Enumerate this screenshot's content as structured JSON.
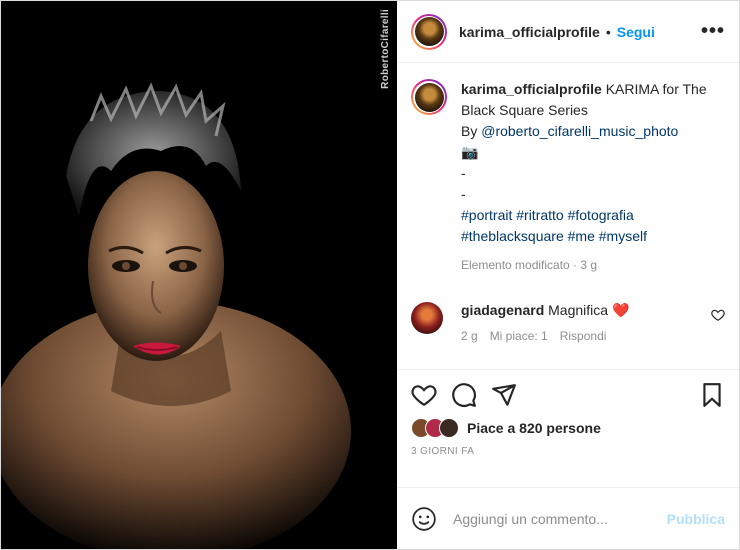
{
  "photo": {
    "watermark": "RobertoCifarelli"
  },
  "header": {
    "username": "karima_officialprofile",
    "separator": "•",
    "follow_label": "Segui",
    "more_label": "•••"
  },
  "caption": {
    "username": "karima_officialprofile",
    "line1": "KARIMA for The Black Square Series",
    "line2_prefix": "By ",
    "mention": "@roberto_cifarelli_music_photo",
    "emoji": "📷",
    "dash1": "-",
    "dash2": "-",
    "hashtags1": "#portrait #ritratto #fotografia",
    "hashtags2": "#theblacksquare #me #myself",
    "meta": "Elemento modificato · 3 g"
  },
  "comment": {
    "username": "giadagenard",
    "text": "Magnifica",
    "emoji": "❤️",
    "time": "2 g",
    "likes": "Mi piace: 1",
    "reply": "Rispondi"
  },
  "actions": {
    "likes_text": "Piace a 820 persone",
    "date": "3 GIORNI FA"
  },
  "add_comment": {
    "placeholder": "Aggiungi un commento...",
    "publish_label": "Pubblica"
  }
}
